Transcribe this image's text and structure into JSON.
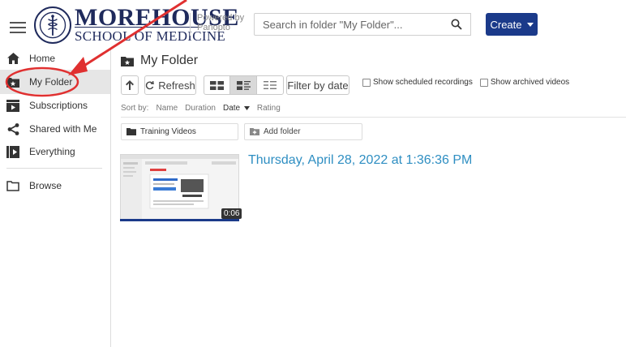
{
  "header": {
    "logo_top": "MOREHOUSE",
    "logo_bottom": "SCHOOL OF MEDICINE",
    "powered_line1": "Powered by",
    "powered_line2": "Panopto",
    "search_placeholder": "Search in folder \"My Folder\"...",
    "create_label": "Create"
  },
  "sidebar": {
    "items": [
      {
        "label": "Home",
        "icon": "home-icon"
      },
      {
        "label": "My Folder",
        "icon": "star-folder-icon",
        "active": true
      },
      {
        "label": "Subscriptions",
        "icon": "subscriptions-icon"
      },
      {
        "label": "Shared with Me",
        "icon": "share-icon"
      },
      {
        "label": "Everything",
        "icon": "everything-icon"
      },
      {
        "label": "Browse",
        "icon": "folder-icon"
      }
    ]
  },
  "main": {
    "folder_title": "My Folder",
    "refresh_label": "Refresh",
    "filter_label": "Filter by date",
    "show_scheduled": "Show scheduled recordings",
    "show_archived": "Show archived videos",
    "sort_by": "Sort by:",
    "sort_options": [
      "Name",
      "Duration",
      "Date",
      "Rating"
    ],
    "subfolders": [
      "Training Videos"
    ],
    "add_folder": "Add folder",
    "session": {
      "title": "Thursday, April 28, 2022 at 1:36:36 PM",
      "duration": "0:06"
    }
  },
  "colors": {
    "brand": "#1f2a5c",
    "create": "#1b3a8a",
    "link": "#2e8ec2",
    "annotation": "#e03030"
  }
}
